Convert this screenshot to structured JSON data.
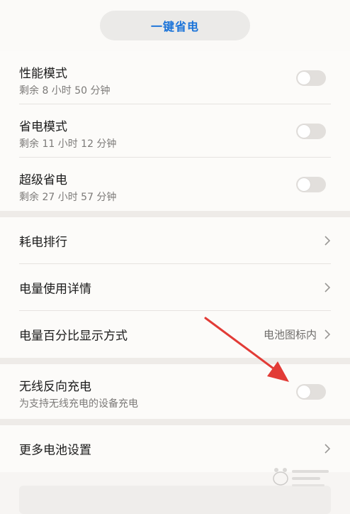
{
  "header": {
    "one_key_label": "一键省电"
  },
  "modes": [
    {
      "title": "性能模式",
      "subtitle": "剩余 8 小时 50 分钟",
      "enabled": false
    },
    {
      "title": "省电模式",
      "subtitle": "剩余 11 小时 12 分钟",
      "enabled": false
    },
    {
      "title": "超级省电",
      "subtitle": "剩余 27 小时 57 分钟",
      "enabled": false
    }
  ],
  "menu": {
    "ranking": "耗电排行",
    "usage_detail": "电量使用详情",
    "percentage_display": "电量百分比显示方式",
    "percentage_value": "电池图标内"
  },
  "reverse_charging": {
    "title": "无线反向充电",
    "subtitle": "为支持无线充电的设备充电",
    "enabled": false
  },
  "more_settings": {
    "title": "更多电池设置"
  },
  "colors": {
    "accent": "#1a73d9",
    "annotation_arrow": "#e23b36"
  },
  "icons": {
    "chevron": "chevron-right-icon",
    "toggle": "toggle-off",
    "arrow": "red-annotation-arrow",
    "watermark": "baidu-jingyan-watermark"
  }
}
